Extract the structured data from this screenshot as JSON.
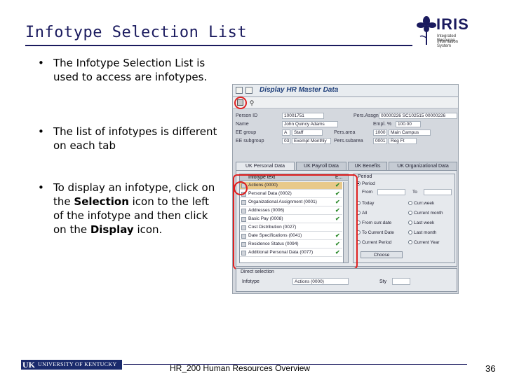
{
  "slide": {
    "title": "Infotype Selection List",
    "logo": {
      "brand": "IRIS",
      "tagline1": "Integrated Resource",
      "tagline2": "Information System"
    },
    "bullets": [
      {
        "text": "The Infotype Selection List is used to access are infotypes."
      },
      {
        "text": "The list of infotypes is different on each tab"
      },
      {
        "pre": "To display an infotype, click on the ",
        "b1": "Selection",
        "mid": " icon to the left of the infotype and then click on the ",
        "b2": "Display",
        "post": " icon."
      }
    ],
    "footer": {
      "logo_mark": "UK",
      "logo_name": "UNIVERSITY OF KENTUCKY",
      "text": "HR_200 Human Resources Overview",
      "page": "36"
    }
  },
  "sap": {
    "window_title": "Display HR Master Data",
    "header_fields": {
      "personnel_no_label": "Person ID",
      "personnel_no": "10001751",
      "pers_assign_label": "Pers.Assgn",
      "pers_assign": "00000226 SC102515 00000226",
      "name_label": "Name",
      "name": "John Quincy Adams",
      "empl_pct_label": "Empl. %",
      "empl_pct": "100.00",
      "ee_group_label": "EE group",
      "ee_group_code": "A",
      "ee_group": "Staff",
      "pers_area_label": "Pers.area",
      "pers_area_code": "1000",
      "pers_area": "Main Campus",
      "ee_subgroup_label": "EE subgroup",
      "ee_subgroup_code": "03",
      "ee_subgroup": "Exempt Monthly",
      "pers_subarea_label": "Pers.subarea",
      "pers_subarea_code": "0001",
      "pers_subarea": "Reg Ft"
    },
    "tabs": [
      "UK Personal Data",
      "UK Payroll Data",
      "UK Benefits",
      "UK Organizational Data"
    ],
    "infotype_list": {
      "header": "Infotype text",
      "header_col": "E...",
      "rows": [
        {
          "name": "Actions (0000)",
          "check": "✔"
        },
        {
          "name": "Personal Data (0002)",
          "check": "✔"
        },
        {
          "name": "Organizational Assignment (0001)",
          "check": "✔"
        },
        {
          "name": "Addresses (0006)",
          "check": "✔"
        },
        {
          "name": "Basic Pay (0008)",
          "check": "✔"
        },
        {
          "name": "Cost Distribution (0027)",
          "check": ""
        },
        {
          "name": "Date Specifications (0041)",
          "check": "✔"
        },
        {
          "name": "Residence Status (0094)",
          "check": "✔"
        },
        {
          "name": "Additional Personal Data (0077)",
          "check": "✔"
        }
      ]
    },
    "period": {
      "header": "Period",
      "period_opt": "Period",
      "from": "From",
      "to": "To",
      "today": "Today",
      "all": "All",
      "from_curr": "From curr.date",
      "to_curr": "To Current Date",
      "curr_period": "Current Period",
      "curr_week": "Curr.week",
      "curr_month": "Current month",
      "last_week": "Last week",
      "last_month": "Last month",
      "curr_year": "Current Year",
      "choose": "Choose"
    },
    "direct_selection": {
      "header": "Direct selection",
      "infotype_label": "Infotype",
      "infotype_value": "Actions (0000)",
      "sty_label": "Sty"
    }
  }
}
